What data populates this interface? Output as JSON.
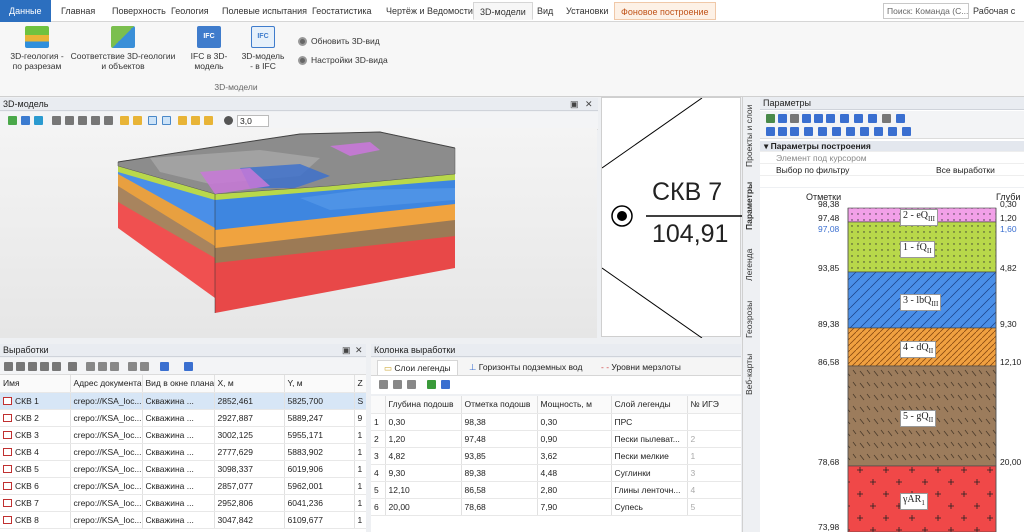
{
  "ribbon_tabs": [
    {
      "label": "Данные",
      "kind": "file"
    },
    {
      "label": "Главная"
    },
    {
      "label": "Поверхность"
    },
    {
      "label": "Геология"
    },
    {
      "label": "Полевые испытания"
    },
    {
      "label": "Геостатистика"
    },
    {
      "label": "Чертёж и Ведомости"
    },
    {
      "label": "3D-модели",
      "active": true
    },
    {
      "label": "Вид"
    },
    {
      "label": "Установки"
    },
    {
      "label": "Фоновое построение",
      "kind": "context"
    }
  ],
  "search": {
    "placeholder": "Поиск: Команда (С..."
  },
  "workspace": "Рабочая с",
  "ribbon": {
    "btn_geo_sections": "3D-геология -\nпо разрезам",
    "btn_geo_objects": "Соответствие 3D-геологии\nи объектов",
    "btn_ifc_to_3d": "IFC в 3D-\nмодель",
    "btn_3d_to_ifc": "3D-модель\n- в IFC",
    "btn_refresh": "Обновить 3D-вид",
    "btn_settings": "Настройки 3D-вида",
    "group_label": "3D-модели"
  },
  "model_panel": {
    "title": "3D-модель",
    "zoom": "3,0"
  },
  "drawing": {
    "well": "СКВ 7",
    "elevation": "104,91"
  },
  "side_tabs": [
    "Проекты и слои",
    "Параметры",
    "Легенда",
    "Геоэрозы",
    "Веб-карты"
  ],
  "params": {
    "title": "Параметры",
    "group": "Параметры построения",
    "rows": [
      {
        "name": "Элемент под курсором",
        "value": ""
      },
      {
        "name": "Выбор по фильтру",
        "value": "Все выработки"
      }
    ]
  },
  "column": {
    "col_elev": "Отметки",
    "col_depth": "Глуби",
    "layers": [
      {
        "label": "2 - eQ",
        "sub": "III",
        "elev_top": "98,38",
        "depth": "0,30",
        "color": "#f2a0e8",
        "pattern": "dots"
      },
      {
        "label": "1 - fQ",
        "sub": "II",
        "elev_top": "97,48",
        "depth": "1,20",
        "color": "#b8d84a",
        "pattern": "dots"
      },
      {
        "label": "3 - lbQ",
        "sub": "III",
        "elev_top": "93,85",
        "depth": "4,82",
        "color": "#4a8fe8",
        "pattern": "hatch"
      },
      {
        "label": "4 - dQ",
        "sub": "II",
        "elev_top": "89,38",
        "depth": "9,30",
        "color": "#f0a040",
        "pattern": "hatch2"
      },
      {
        "label": "5 - gQ",
        "sub": "II",
        "elev_top": "86,58",
        "depth": "12,10",
        "color": "#9c7c5c",
        "pattern": "dash"
      },
      {
        "label": "γAR",
        "sub": "1",
        "elev_top": "78,68",
        "depth": "20,00",
        "color": "#f04848",
        "pattern": "plus"
      }
    ],
    "extra_elev": "97,08",
    "extra_depth": "1,60",
    "bottom_elev": "73,98"
  },
  "wells_panel": {
    "title": "Выработки",
    "headers": [
      "Имя",
      "Адрес документа",
      "Вид в окне плана",
      "X, м",
      "Y, м",
      "Ζ"
    ],
    "rows": [
      {
        "name": "СКВ 1",
        "addr": "crepo://KSA_loc...",
        "view": "Скважина ...",
        "x": "2852,461",
        "y": "5825,700",
        "z": "S"
      },
      {
        "name": "СКВ 2",
        "addr": "crepo://KSA_loc...",
        "view": "Скважина ...",
        "x": "2927,887",
        "y": "5889,247",
        "z": "9"
      },
      {
        "name": "СКВ 3",
        "addr": "crepo://KSA_loc...",
        "view": "Скважина ...",
        "x": "3002,125",
        "y": "5955,171",
        "z": "1"
      },
      {
        "name": "СКВ 4",
        "addr": "crepo://KSA_loc...",
        "view": "Скважина ...",
        "x": "2777,629",
        "y": "5883,902",
        "z": "1"
      },
      {
        "name": "СКВ 5",
        "addr": "crepo://KSA_loc...",
        "view": "Скважина ...",
        "x": "3098,337",
        "y": "6019,906",
        "z": "1"
      },
      {
        "name": "СКВ 6",
        "addr": "crepo://KSA_loc...",
        "view": "Скважина ...",
        "x": "2857,077",
        "y": "5962,001",
        "z": "1"
      },
      {
        "name": "СКВ 7",
        "addr": "crepo://KSA_loc...",
        "view": "Скважина ...",
        "x": "2952,806",
        "y": "6041,236",
        "z": "1"
      },
      {
        "name": "СКВ 8",
        "addr": "crepo://KSA_loc...",
        "view": "Скважина ...",
        "x": "3047,842",
        "y": "6109,677",
        "z": "1"
      }
    ]
  },
  "column_panel": {
    "title": "Колонка выработки",
    "tabs": [
      "Слои легенды",
      "Горизонты подземных вод",
      "Уровни мерзлоты"
    ],
    "headers": [
      "",
      "Глубина подошв",
      "Отметка подошв",
      "Мощность, м",
      "Слой легенды",
      "№ ИГЭ"
    ],
    "rows": [
      {
        "n": "1",
        "depth": "0,30",
        "elev": "98,38",
        "thick": "0,30",
        "layer": "ПРС",
        "ige": ""
      },
      {
        "n": "2",
        "depth": "1,20",
        "elev": "97,48",
        "thick": "0,90",
        "layer": "Пески пылеват...",
        "ige": "2"
      },
      {
        "n": "3",
        "depth": "4,82",
        "elev": "93,85",
        "thick": "3,62",
        "layer": "Пески мелкие",
        "ige": "1"
      },
      {
        "n": "4",
        "depth": "9,30",
        "elev": "89,38",
        "thick": "4,48",
        "layer": "Суглинки",
        "ige": "3"
      },
      {
        "n": "5",
        "depth": "12,10",
        "elev": "86,58",
        "thick": "2,80",
        "layer": "Глины ленточн...",
        "ige": "4"
      },
      {
        "n": "6",
        "depth": "20,00",
        "elev": "78,68",
        "thick": "7,90",
        "layer": "Супесь",
        "ige": "5"
      }
    ]
  }
}
